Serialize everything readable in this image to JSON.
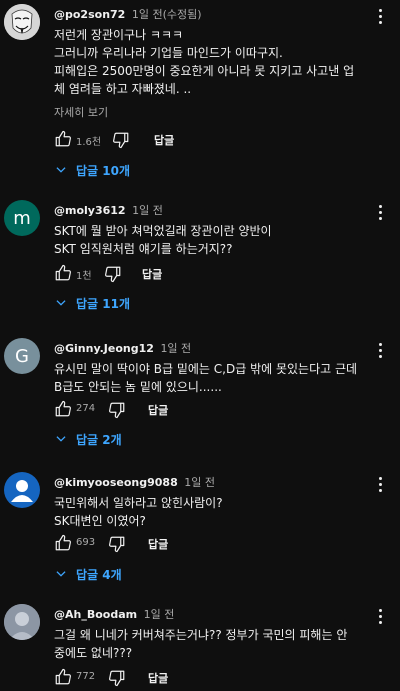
{
  "comments": [
    {
      "author": "@po2son72",
      "time": "1일 전(수정됨)",
      "avatar_letter": "",
      "avatar_color": "#cfcfcf",
      "lines": [
        "저런게 장관이구나 ㅋㅋㅋ",
        "그러니까 우리나라 기업들 마인드가 이따구지.",
        "피해입은 2500만명이 중요한게 아니라 못 지키고 사고낸 업",
        "체 염려들 하고 자빠졌네. .."
      ],
      "read_more": "자세히 보기",
      "likes": "1.6천",
      "reply_label": "답글",
      "replies_label": "답글 10개"
    },
    {
      "author": "@moly3612",
      "time": "1일 전",
      "avatar_letter": "m",
      "avatar_color": "#00695c",
      "lines": [
        "SKT에 뭘 받아 쳐먹었길래 장관이란 양반이",
        "SKT 임직원처럼 얘기를 하는거지??"
      ],
      "likes": "1천",
      "reply_label": "답글",
      "replies_label": "답글 11개"
    },
    {
      "author": "@Ginny.Jeong12",
      "time": "1일 전",
      "avatar_letter": "G",
      "avatar_color": "#78909c",
      "lines": [
        "유시민 말이 딱이야 B급 밑에는 C,D급 밖에 못있는다고 근데",
        "B급도 안되는 놈 밑에 있으니......"
      ],
      "likes": "274",
      "reply_label": "답글",
      "replies_label": "답글 2개"
    },
    {
      "author": "@kimyooseong9088",
      "time": "1일 전",
      "avatar_letter": "",
      "avatar_color": "#1565c0",
      "lines": [
        "국민위해서 일하라고 앉힌사람이?",
        "SK대변인 이였어?"
      ],
      "likes": "693",
      "reply_label": "답글",
      "replies_label": "답글 4개"
    },
    {
      "author": "@Ah_Boodam",
      "time": "1일 전",
      "avatar_letter": "",
      "avatar_color": "#9aa4b2",
      "lines": [
        "그걸 왜 니네가 커버쳐주는거냐?? 정부가 국민의 피해는 안",
        "중에도 없네???"
      ],
      "likes": "772",
      "reply_label": "답글"
    }
  ],
  "colors": {
    "background": "#0f0f0f",
    "link": "#3ea6ff",
    "muted": "#aaaaaa",
    "text": "#f1f1f1"
  },
  "icons": [
    "more-vert-icon",
    "thumb-up-icon",
    "thumb-down-icon",
    "chevron-down-icon"
  ]
}
